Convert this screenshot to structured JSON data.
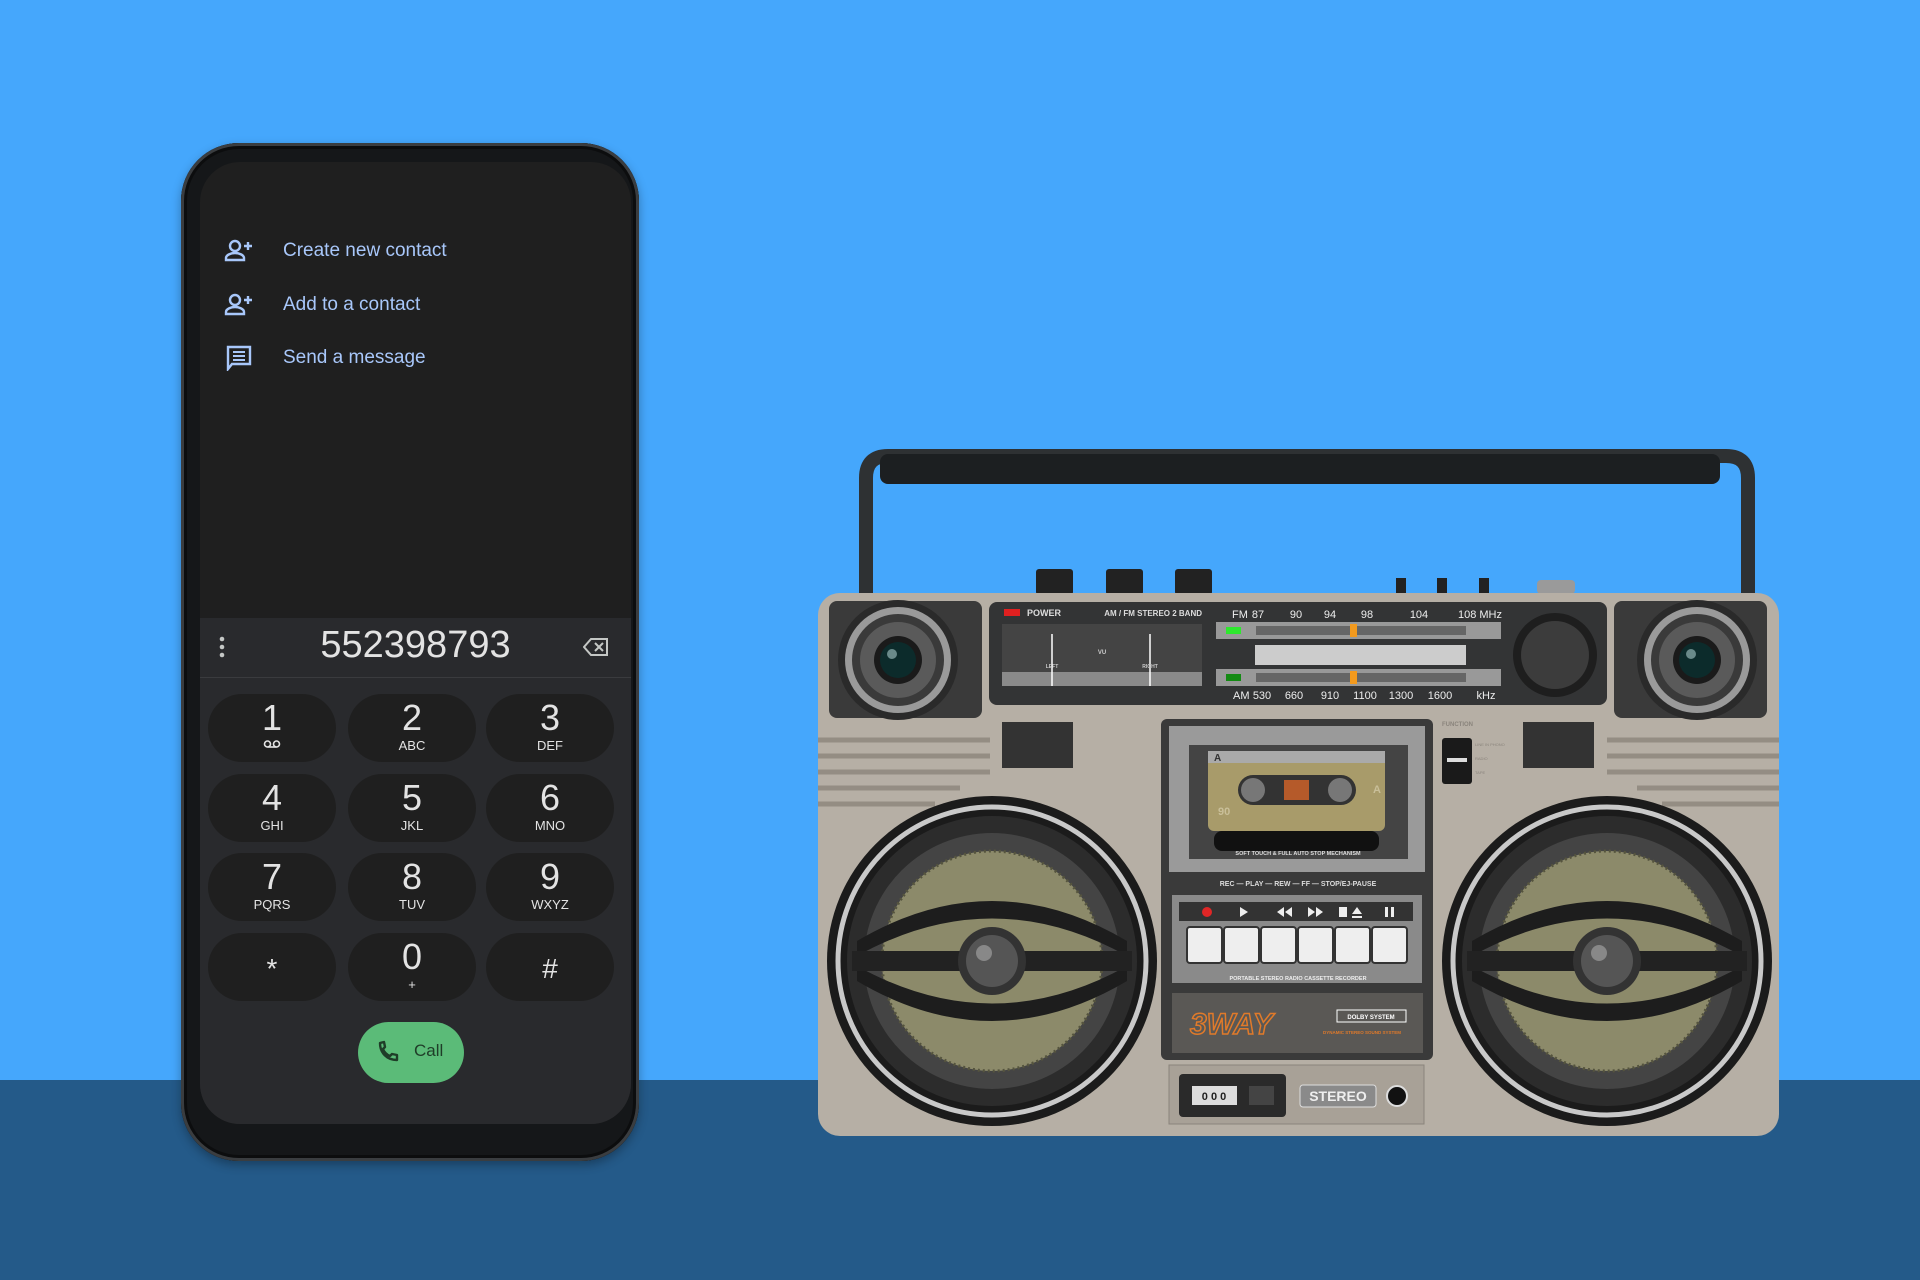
{
  "colors": {
    "sky": "#45a7fc",
    "floor": "#245a89",
    "accent": "#a8c7fa",
    "call_green": "#5bbb78"
  },
  "phone": {
    "menu": [
      {
        "icon": "person-add-icon",
        "label": "Create new contact"
      },
      {
        "icon": "person-add-icon",
        "label": "Add to a contact"
      },
      {
        "icon": "message-icon",
        "label": "Send a message"
      }
    ],
    "dialed_number": "552398793",
    "keys": [
      {
        "digit": "1",
        "sub": "voicemail-icon"
      },
      {
        "digit": "2",
        "sub": "ABC"
      },
      {
        "digit": "3",
        "sub": "DEF"
      },
      {
        "digit": "4",
        "sub": "GHI"
      },
      {
        "digit": "5",
        "sub": "JKL"
      },
      {
        "digit": "6",
        "sub": "MNO"
      },
      {
        "digit": "7",
        "sub": "PQRS"
      },
      {
        "digit": "8",
        "sub": "TUV"
      },
      {
        "digit": "9",
        "sub": "WXYZ"
      },
      {
        "digit": "*",
        "sub": ""
      },
      {
        "digit": "0",
        "sub": "+"
      },
      {
        "digit": "#",
        "sub": ""
      }
    ],
    "call_label": "Call"
  },
  "boombox": {
    "power": "POWER",
    "band": "AM / FM STEREO 2 BAND",
    "vu": "VU",
    "left": "LEFT",
    "right": "RIGHT",
    "fm": "FM",
    "fm_ticks": [
      "87",
      "90",
      "94",
      "98",
      "104",
      "108 MHz"
    ],
    "am": "AM",
    "am_ticks": [
      "530",
      "660",
      "910",
      "1100",
      "1300",
      "1600"
    ],
    "khz": "kHz",
    "function": "FUNCTION",
    "func_opts": [
      "LINE IN PHONO",
      "RADIO",
      "TAPE"
    ],
    "tape_side": "A",
    "tape_len": "90",
    "mechanism": "SOFT TOUCH & FULL AUTO STOP MECHANISM",
    "controls": "REC — PLAY — REW — FF — STOP/EJ-PAUSE",
    "tagline": "PORTABLE  STEREO  RADIO  CASSETTE  RECORDER",
    "logo": "3WAY",
    "dolby": "DOLBY SYSTEM",
    "dynamic": "DYNAMIC STEREO SOUND SYSTEM",
    "counter": "0 0 0",
    "stereo": "STEREO"
  }
}
